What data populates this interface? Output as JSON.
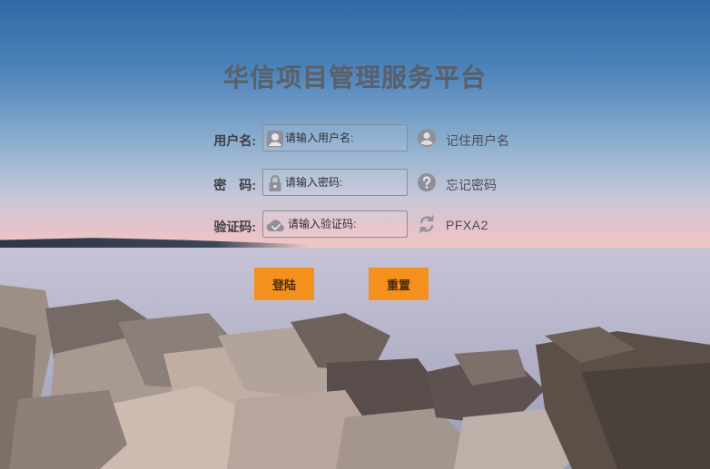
{
  "page": {
    "title": "华信项目管理服务平台"
  },
  "form": {
    "username": {
      "label": "用户名:",
      "placeholder": "请输入用户名:",
      "value": ""
    },
    "password": {
      "label": "密　码:",
      "placeholder": "请输入密码:",
      "value": ""
    },
    "captcha": {
      "label": "验证码:",
      "placeholder": "请输入验证码:",
      "value": "",
      "code": "PFXA2"
    },
    "remember_label": "记住用户名",
    "forgot_label": "忘记密码"
  },
  "buttons": {
    "login_label": "登陆",
    "reset_label": "重置"
  },
  "colors": {
    "accent": "#f4911e",
    "title": "#5a5f68",
    "icon": "#8e8f98"
  },
  "icons": {
    "username": "user-icon",
    "password": "lock-icon",
    "captcha": "cloud-check-icon",
    "remember": "avatar-circle-icon",
    "forgot": "question-circle-icon",
    "refresh": "refresh-icon"
  }
}
